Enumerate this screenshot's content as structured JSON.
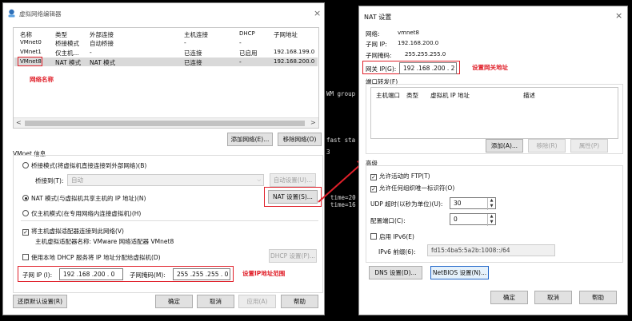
{
  "colors": {
    "accent_red": "#e0202a",
    "selected_row": "#d9d9d9",
    "terminal_text": "#dcdcdc"
  },
  "left": {
    "title": "虚拟网络编辑器",
    "close": "×",
    "columns": [
      "名称",
      "类型",
      "外部连接",
      "主机连接",
      "DHCP",
      "子网地址"
    ],
    "rows": [
      [
        "VMnet0",
        "桥接模式",
        "自动桥接",
        "-",
        "-",
        ""
      ],
      [
        "VMnet1",
        "仅主机...",
        "-",
        "已连接",
        "已启用",
        "192.168.199.0"
      ],
      [
        "VMnet8",
        "NAT 模式",
        "NAT 模式",
        "已连接",
        "-",
        "192.168.200.0"
      ]
    ],
    "annot_name": "网络名称",
    "scroll_left": "<",
    "scroll_right": ">",
    "add_net": "添加网络(E)...",
    "remove_net": "移除网络(O)",
    "info_title": "VMnet 信息",
    "bridge_mode": "桥接模式(将虚拟机直接连接到外部网络)(B)",
    "bridge_to_label": "桥接到(T):",
    "bridge_to_value": "自动",
    "auto_settings": "自动设置(U)...",
    "nat_mode": "NAT 模式(与虚拟机共享主机的 IP 地址)(N)",
    "nat_settings": "NAT 设置(S)...",
    "host_only": "仅主机模式(在专用网络内连接虚拟机)(H)",
    "connect_adapter": "将主机虚拟适配器连接到此网络(V)",
    "adapter_name": "主机虚拟适配器名称: VMware 网络适配器 VMnet8",
    "use_dhcp": "使用本地 DHCP 服务将 IP 地址分配给虚拟机(D)",
    "dhcp_settings": "DHCP 设置(P)...",
    "subnet_ip_label": "子网 IP (I):",
    "subnet_ip": "192 .168 .200 .  0",
    "mask_label": "子网掩码(M):",
    "mask": "255 .255 .255 .  0",
    "annot_subnet": "设置IP地址范围",
    "restore": "还原默认设置(R)",
    "ok": "确定",
    "cancel": "取消",
    "apply": "应用(A)",
    "help": "帮助"
  },
  "terminal": [
    "WM group",
    "fast sta",
    "3",
    "time=20",
    "time=16"
  ],
  "right": {
    "title": "NAT 设置",
    "close": "×",
    "network_label": "网络:",
    "network_value": "vmnet8",
    "subnet_ip_label": "子网 IP:",
    "subnet_ip_value": "192.168.200.0",
    "mask_label": "子网掩码:",
    "mask_value": "255.255.255.0",
    "gateway_label": "网关 IP(G):",
    "gateway_value": "192 .168 .200 .  2",
    "annot_gateway": "设置网关地址",
    "port_forward_title": "端口转发(F)",
    "pf_columns": [
      "主机端口",
      "类型",
      "虚拟机 IP 地址",
      "描述"
    ],
    "pf_add": "添加(A)...",
    "pf_remove": "移除(R)",
    "pf_props": "属性(P)",
    "advanced_title": "高级",
    "allow_ftp": "允许活动的 FTP(T)",
    "allow_uuid": "允许任何组织唯一标识符(O)",
    "udp_label": "UDP 超时(以秒为单位)(U):",
    "udp_value": "30",
    "config_port_label": "配置端口(C):",
    "config_port_value": "0",
    "enable_ipv6": "启用 IPv6(E)",
    "ipv6_prefix_label": "IPv6 前缀(6):",
    "ipv6_prefix_value": "fd15:4ba5:5a2b:1008::/64",
    "dns_settings": "DNS 设置(D)...",
    "netbios_settings": "NetBIOS 设置(N)...",
    "ok": "确定",
    "cancel": "取消",
    "help": "帮助"
  }
}
